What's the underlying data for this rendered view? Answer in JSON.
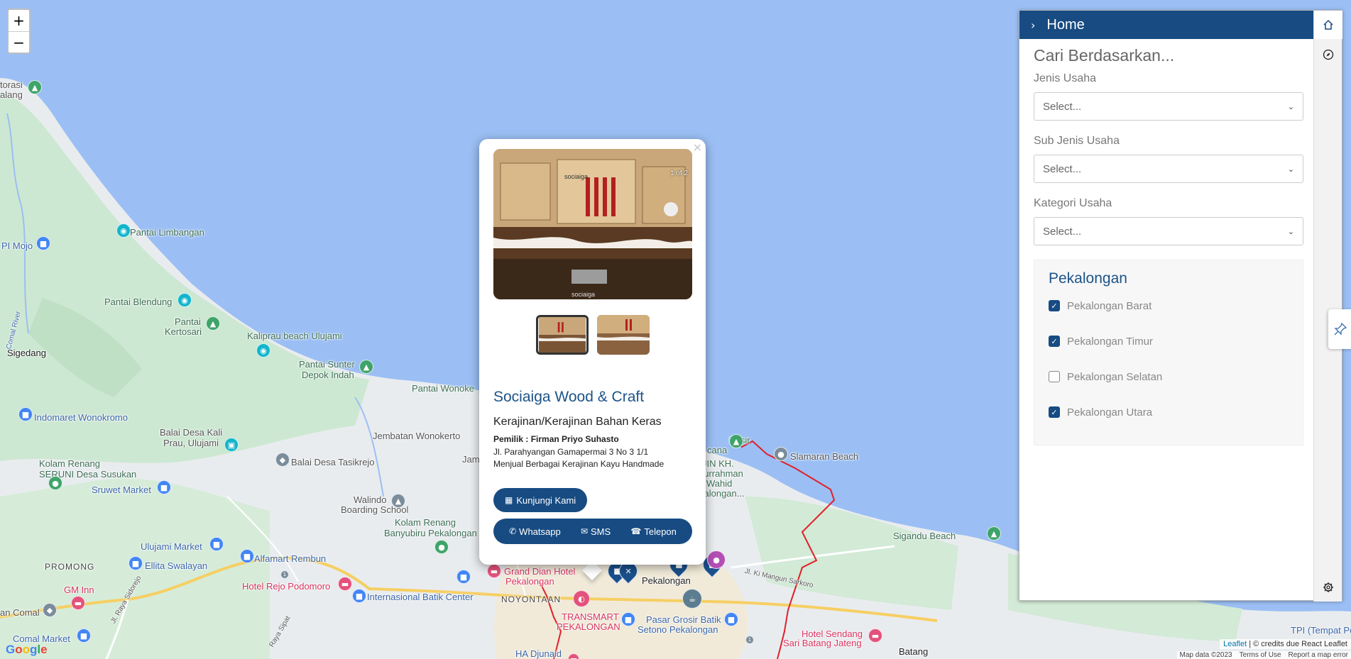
{
  "map": {
    "zoom_in": "+",
    "zoom_out": "−",
    "google": "Google",
    "attribution_leaflet": "Leaflet",
    "attribution_text": "| © credits due React Leaflet",
    "footer_mapdata": "Map data ©2023",
    "footer_terms": "Terms of Use",
    "footer_report": "Report a map error",
    "labels": {
      "l01": "torasi",
      "l02": "alang",
      "l03": "Pantai Limbangan",
      "l04": "PI Mojo",
      "l05": "Pantai Blendung",
      "l06": "Pantai",
      "l07": "Kertosari",
      "l08": "Kaliprau beach Ulujami",
      "l09": "Sigedang",
      "l10": "Pantai Sunter",
      "l11": "Depok Indah",
      "l12": "Pantai Wonoke",
      "l13": "Indomaret Wonokromo",
      "l14": "Balai Desa Kali",
      "l15": "Prau, Ulujami",
      "l16": "Jembatan Wonokerto",
      "l17": "Balai Desa Tasikrejo",
      "l18": "Kolam Renang",
      "l19": "SERUNI Desa Susukan",
      "l20": "Sruwet Market",
      "l21": "Walindo",
      "l22": "Boarding School",
      "l23": "Kolam Renang",
      "l24": "Banyubiru Pekalongan",
      "l25": "Ulujami Market",
      "l26": "Alfamart Rembun",
      "l27": "Ellita Swalayan",
      "l28": "PROMONG",
      "l29": "GM Inn",
      "l30": "Hotel Rejo Podomoro",
      "l31": "Internasional Batik Center",
      "l32": "Grand Dian Hotel",
      "l33": "Pekalongan",
      "l34": "NOYONTAAN",
      "l35": "Pekalongan",
      "l36": "TRANSMART",
      "l37": "PEKALONGAN",
      "l38": "Pasar Grosir Batik",
      "l39": "Setono Pekalongan",
      "l40": "Comal Market",
      "l41": "an Comal",
      "l42": "Jl. Raya Sidorejo",
      "l43": "HA Djunaid",
      "l44": "Hotel Sendang",
      "l45": "Sari Batang Jateng",
      "l46": "Batang",
      "l47": "TPI (Tempat Pele",
      "l48": "Sigandu Beach",
      "l49": "Slamaran Beach",
      "l50": "Pasir",
      "l51": "JIN KH.",
      "l52": "durrahman",
      "l53": "Wahid",
      "l54": "kalongan...",
      "l55": "Jl. Ki Mangun Sarkoro",
      "l56": "Jam",
      "l57": "Comal River",
      "l58": "Raya Sipat",
      "l59": "cana"
    }
  },
  "popup": {
    "close": "×",
    "counter": "1 of 2",
    "name": "Sociaiga Wood & Craft",
    "category": "Kerajinan/Kerajinan Bahan Keras",
    "owner": "Pemilik : Firman Priyo Suhasto",
    "address": "Jl. Parahyangan Gamapermai 3 No 3 1/1",
    "description": "Menjual Berbagai Kerajinan Kayu Handmade",
    "visit_label": "Kunjungi Kami",
    "whatsapp_label": "Whatsapp",
    "sms_label": "SMS",
    "phone_label": "Telepon"
  },
  "sidebar": {
    "header_title": "Home",
    "heading": "Cari Berdasarkan...",
    "fields": [
      {
        "label": "Jenis Usaha",
        "value": "Select..."
      },
      {
        "label": "Sub Jenis Usaha",
        "value": "Select..."
      },
      {
        "label": "Kategori Usaha",
        "value": "Select..."
      }
    ],
    "region_title": "Pekalongan",
    "regions": [
      {
        "label": "Pekalongan Barat",
        "checked": true
      },
      {
        "label": "Pekalongan Timur",
        "checked": true
      },
      {
        "label": "Pekalongan Selatan",
        "checked": false
      },
      {
        "label": "Pekalongan Utara",
        "checked": true
      }
    ]
  },
  "colors": {
    "sea": "#9bbff4",
    "land": "#e8ecee",
    "park": "#c7e6cb",
    "primary": "#174b82",
    "boundary": "#e0202a",
    "road": "#f8d774"
  }
}
